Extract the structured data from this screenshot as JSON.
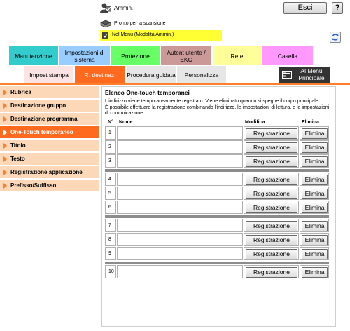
{
  "header": {
    "admin_label": "Ammin.",
    "logout_label": "Esci",
    "help_label": "?",
    "status_text": "Pronto per la scansione",
    "mode_text": "Nel Menu (Modalità Ammin.)"
  },
  "main_tabs": [
    {
      "label": "Manutenzione",
      "color": "#33cccc"
    },
    {
      "label": "Impostazioni di sistema",
      "color": "#99ccff"
    },
    {
      "label": "Protezione",
      "color": "#66ff66"
    },
    {
      "label": "Autent utente / EKC",
      "color": "#cc9999"
    },
    {
      "label": "Rete",
      "color": "#ffff99"
    },
    {
      "label": "Casella",
      "color": "#ff99ff"
    }
  ],
  "sub_tabs": [
    {
      "label": "Impost stampa"
    },
    {
      "label": "R. destinaz."
    },
    {
      "label": "Procedura guidata"
    },
    {
      "label": "Personalizza"
    }
  ],
  "menu_button": {
    "line1": "Al Menu",
    "line2": "Principale"
  },
  "sidebar": {
    "items": [
      {
        "label": "Rubrica"
      },
      {
        "label": "Destinazione gruppo"
      },
      {
        "label": "Destinazione programma"
      },
      {
        "label": "One-Touch temporaneo"
      },
      {
        "label": "Titolo"
      },
      {
        "label": "Testo"
      },
      {
        "label": "Registrazione applicazione"
      },
      {
        "label": "Prefisso/Suffisso"
      }
    ],
    "active_index": 3
  },
  "content": {
    "title": "Elenco One-touch temporanei",
    "description_1": "L'indirizzo viene temporaneamente registrato. Viene eliminato quando si spegne il corpo principale.",
    "description_2": "È possibile effettuare la registrazione combinando l'indirizzo, le impostazioni di lettura, e le impostazioni di comunicazione.",
    "columns": {
      "num": "N°",
      "name": "Nome",
      "edit": "Modifica",
      "delete": "Elimina"
    },
    "register_label": "Registrazione",
    "delete_label": "Elimina",
    "rows": [
      {
        "num": "1",
        "name": ""
      },
      {
        "num": "2",
        "name": ""
      },
      {
        "num": "3",
        "name": ""
      },
      {
        "num": "4",
        "name": ""
      },
      {
        "num": "5",
        "name": ""
      },
      {
        "num": "6",
        "name": ""
      },
      {
        "num": "7",
        "name": ""
      },
      {
        "num": "8",
        "name": ""
      },
      {
        "num": "9",
        "name": ""
      },
      {
        "num": "10",
        "name": ""
      }
    ]
  }
}
